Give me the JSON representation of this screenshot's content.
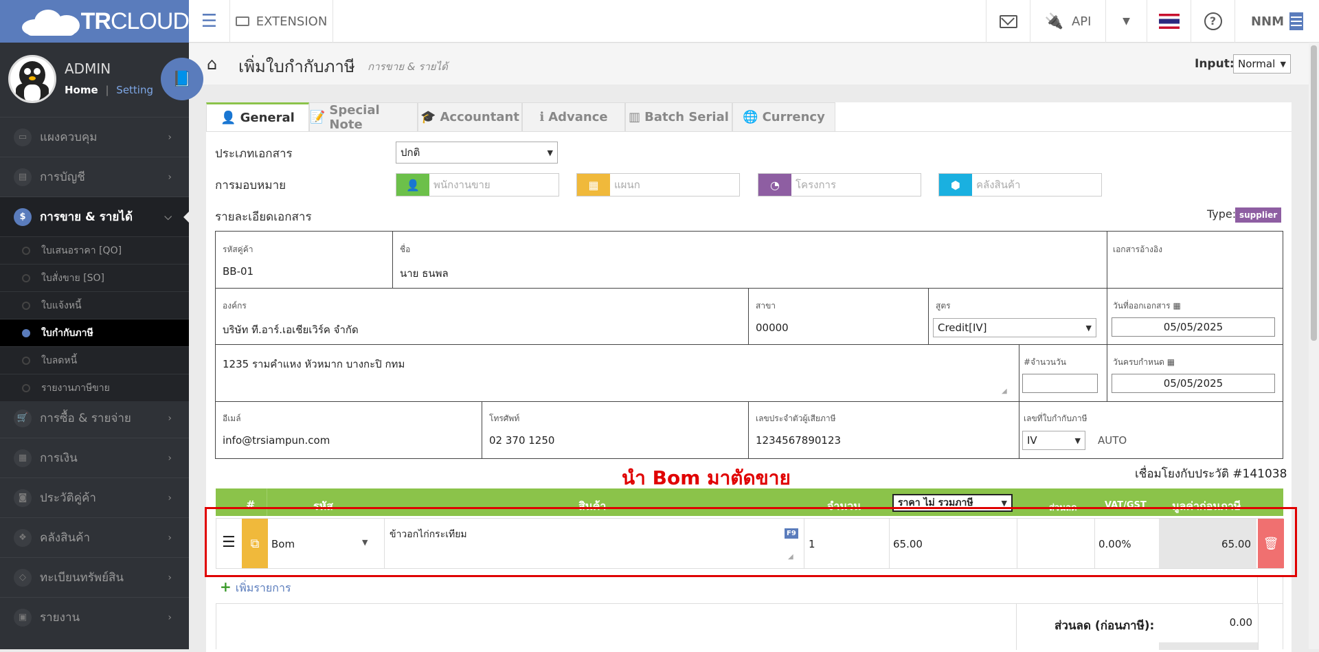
{
  "brand": {
    "name_bold": "TR",
    "name_light": "CLOUD"
  },
  "topbar": {
    "extension_label": "EXTENSION",
    "api_label": "API",
    "user": "NNM"
  },
  "profile": {
    "name": "ADMIN",
    "home": "Home",
    "sep": "|",
    "setting": "Setting"
  },
  "sidebar": {
    "items": [
      {
        "label": "แผงควบคุม",
        "icon": "monitor-icon"
      },
      {
        "label": "การบัญชี",
        "icon": "book-icon"
      },
      {
        "label": "การขาย & รายได้",
        "icon": "dollar-icon",
        "active": true
      },
      {
        "label": "การซื้อ & รายจ่าย",
        "icon": "cart-icon"
      },
      {
        "label": "การเงิน",
        "icon": "calendar-icon"
      },
      {
        "label": "ประวัติคู่ค้า",
        "icon": "contact-icon"
      },
      {
        "label": "คลังสินค้า",
        "icon": "boxes-icon"
      },
      {
        "label": "ทะเบียนทรัพย์สิน",
        "icon": "diamond-icon"
      },
      {
        "label": "รายงาน",
        "icon": "report-icon"
      }
    ],
    "sub_items": [
      "ใบเสนอราคา [QO]",
      "ใบสั่งขาย [SO]",
      "ใบแจ้งหนี้",
      "ใบกำกับภาษี",
      "ใบลดหนี้",
      "รายงานภาษีขาย"
    ]
  },
  "page": {
    "title": "เพิ่มใบกำกับภาษี",
    "breadcrumb": "การขาย & รายได้",
    "input_label": "Input:",
    "input_value": "Normal"
  },
  "tabs": [
    "General",
    "Special Note",
    "Accountant",
    "Advance",
    "Batch Serial",
    "Currency"
  ],
  "form": {
    "doc_type_label": "ประเภทเอกสาร",
    "doc_type_value": "ปกติ",
    "assign_label": "การมอบหมาย",
    "assign": [
      {
        "placeholder": "พนักงานขาย",
        "color": "#6cc04a"
      },
      {
        "placeholder": "แผนก",
        "color": "#f0b93b"
      },
      {
        "placeholder": "โครงการ",
        "color": "#8e5ea2"
      },
      {
        "placeholder": "คลังสินค้า",
        "color": "#1ab0e0"
      }
    ],
    "detail_label": "รายละเอียดเอกสาร",
    "type_label": "Type:",
    "type_badge": "supplier"
  },
  "details": {
    "partner_code_label": "รหัสคู่ค้า",
    "partner_code": "BB-01",
    "name_label": "ชื่อ",
    "name": "นาย ธนพล",
    "ref_label": "เอกสารอ้างอิง",
    "org_label": "องค์กร",
    "org": "บริษัท ที.อาร์.เอเชียเวิร์ค จำกัด",
    "branch_label": "สาขา",
    "branch": "00000",
    "formula_label": "สูตร",
    "formula": "Credit[IV]",
    "issue_date_label": "วันที่ออกเอกสาร",
    "issue_date": "05/05/2025",
    "address": "1235 รามคำแหง หัวหมาก บางกะปิ กทม",
    "days_label": "#จำนวนวัน",
    "due_date_label": "วันครบกำหนด",
    "due_date": "05/05/2025",
    "email_label": "อีเมล์",
    "email": "info@trsiampun.com",
    "phone_label": "โทรศัพท์",
    "phone": "02 370 1250",
    "tax_id_label": "เลขประจำตัวผู้เสียภาษี",
    "tax_id": "1234567890123",
    "invoice_no_label": "เลขที่ใบกำกับภาษี",
    "invoice_prefix": "IV",
    "invoice_auto": "AUTO"
  },
  "annotation": "นำ Bom มาตัดขาย",
  "history_link": "เชื่อมโยงกับประวัติ #141038",
  "table": {
    "headers": {
      "num": "#",
      "code": "รหัส",
      "product": "สินค้า",
      "qty": "จำนวน",
      "price_mode": "ราคา ไม่ รวมภาษี",
      "discount": "ส่วนลด",
      "vat": "VAT/GST",
      "amount": "มูลค่าก่อนภาษี"
    },
    "row": {
      "code": "Bom",
      "product": "ข้าวอกไก่กระเทียม",
      "f9": "F9",
      "qty": "1",
      "price": "65.00",
      "discount": "",
      "vat": "0.00%",
      "amount": "65.00"
    },
    "add_item": "เพิ่มรายการ"
  },
  "summary": {
    "discount_label": "ส่วนลด (ก่อนภาษี):",
    "discount_value": "0.00"
  }
}
